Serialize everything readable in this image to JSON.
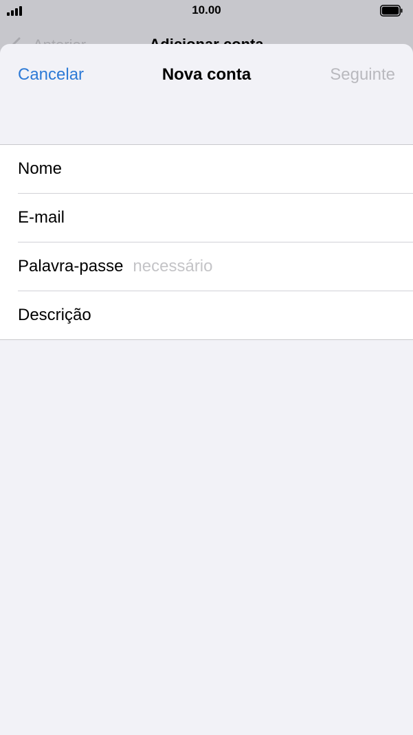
{
  "status_bar": {
    "time": "10.00"
  },
  "background_nav": {
    "back_label": "Anterior",
    "title": "Adicionar conta"
  },
  "sheet": {
    "cancel_label": "Cancelar",
    "title": "Nova conta",
    "next_label": "Seguinte"
  },
  "form": {
    "fields": [
      {
        "label": "Nome",
        "value": "",
        "placeholder": ""
      },
      {
        "label": "E-mail",
        "value": "",
        "placeholder": ""
      },
      {
        "label": "Palavra-passe",
        "value": "",
        "placeholder": "necessário"
      },
      {
        "label": "Descrição",
        "value": "",
        "placeholder": ""
      }
    ]
  },
  "colors": {
    "accent": "#2d7ad6",
    "disabled": "#b9b9be",
    "placeholder": "#c4c4c7",
    "sheet_background": "#f2f2f7"
  },
  "icons": [
    "signal-icon",
    "battery-icon",
    "back-chevron-icon"
  ]
}
